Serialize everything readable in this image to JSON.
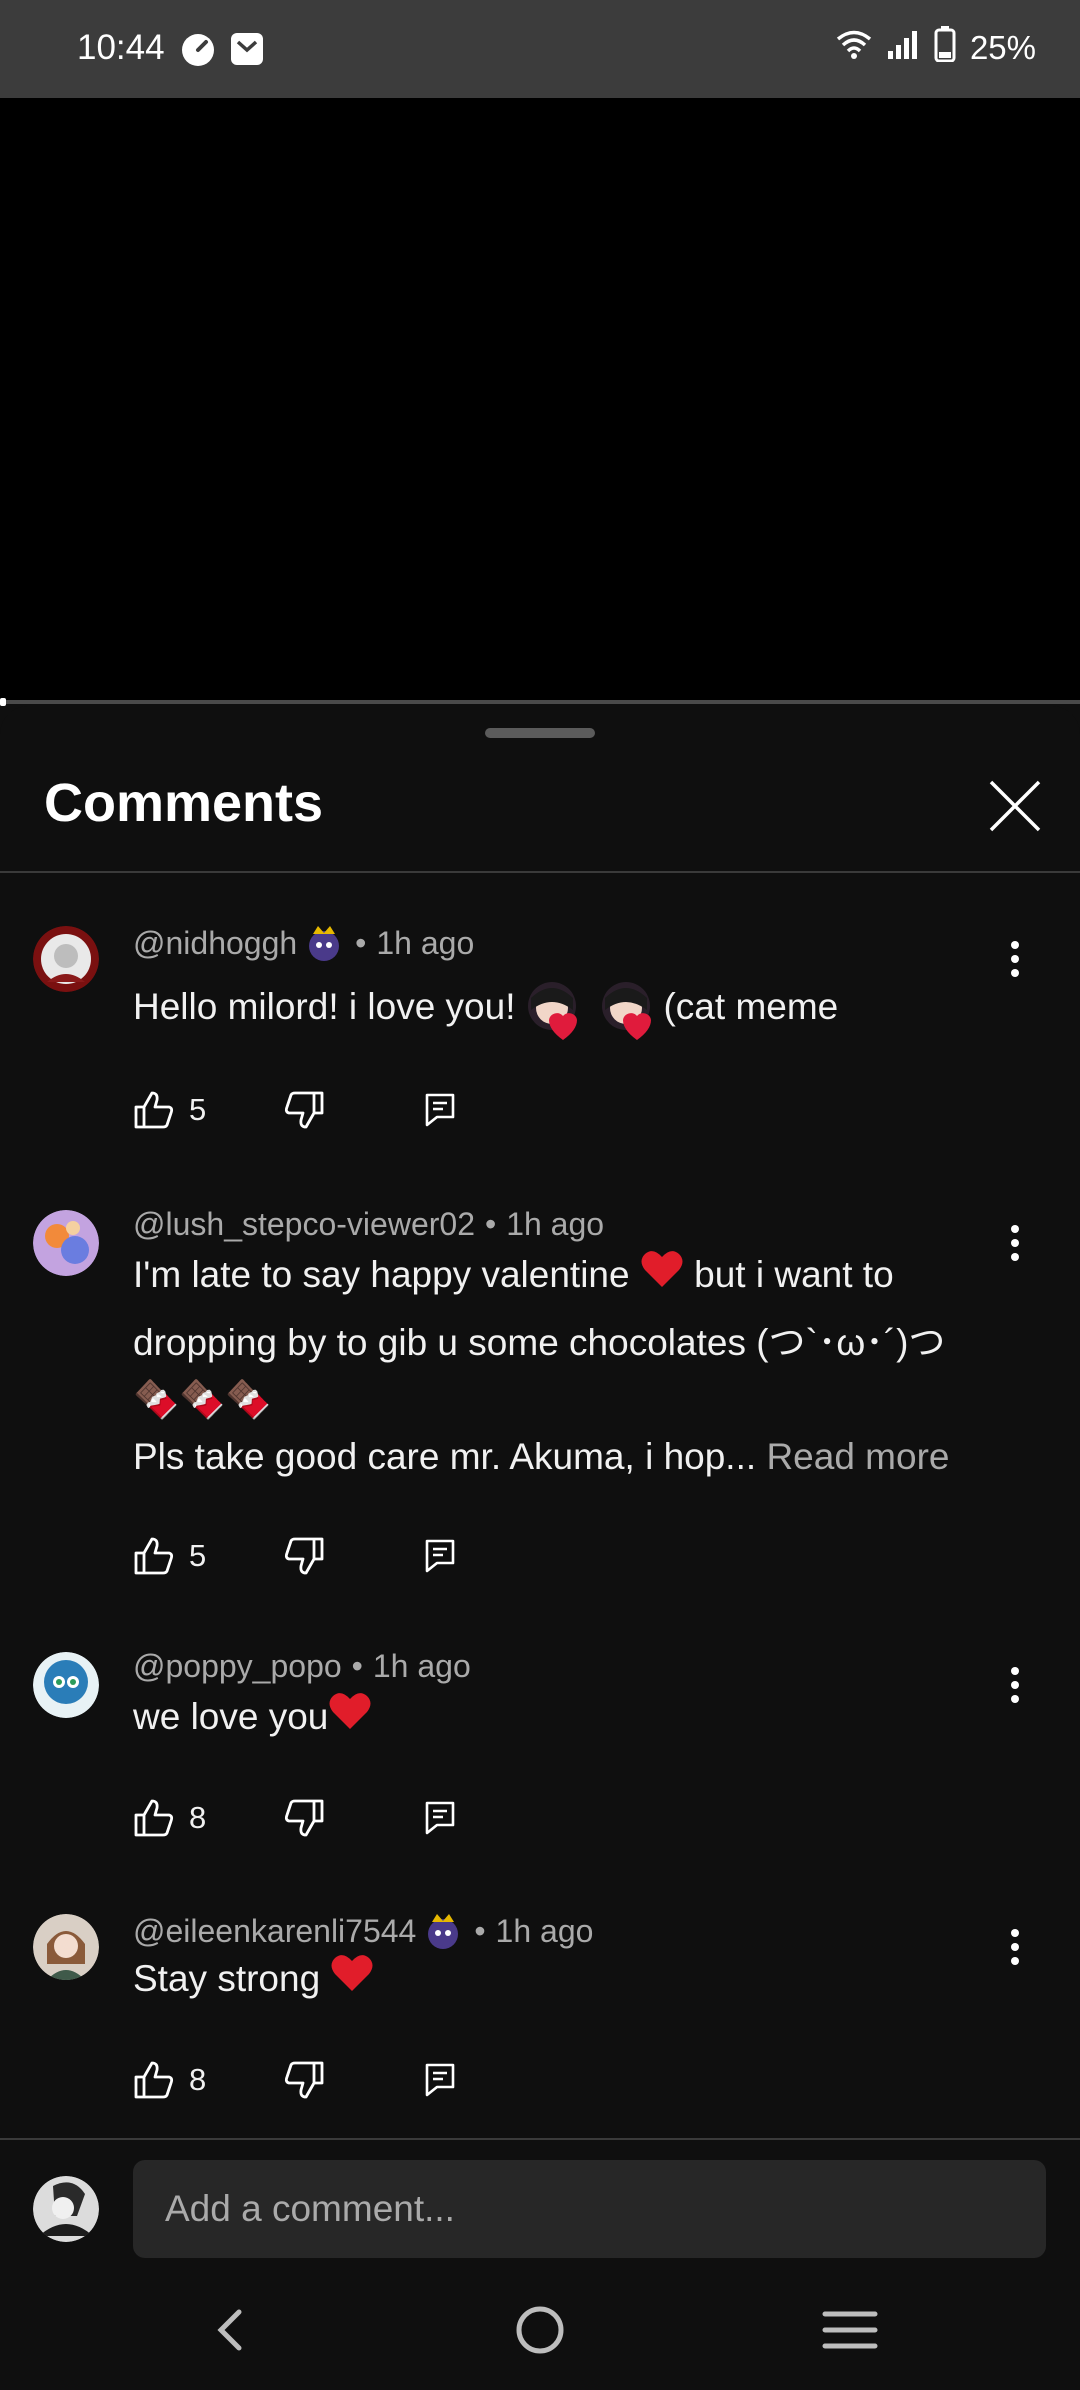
{
  "status_bar": {
    "time": "10:44",
    "battery": "25%"
  },
  "sheet": {
    "title": "Comments"
  },
  "comments": [
    {
      "author": "@nidhoggh",
      "time": "1h ago",
      "text_a": "Hello milord! i love you!",
      "text_b": "(cat meme",
      "likes": "5"
    },
    {
      "author": "@lush_stepco-viewer02",
      "time": "1h ago",
      "line1": "I'm late to say happy valentine",
      "line1b": " but i want to",
      "line2": "dropping by to gib u some chocolates (つ`･ω･´)つ",
      "line3": "🍫🍫🍫",
      "line4": "Pls take good care mr. Akuma, i hop...",
      "read_more": "Read more",
      "likes": "5"
    },
    {
      "author": "@poppy_popo",
      "time": "1h ago",
      "text": "we love you",
      "likes": "8"
    },
    {
      "author": "@eileenkarenli7544",
      "time": "1h ago",
      "text": "Stay strong",
      "likes": "8"
    }
  ],
  "composer": {
    "placeholder": "Add a comment..."
  },
  "colors": {
    "background": "#0f0f0f",
    "heart": "#e11d2a",
    "muted_text": "#aaaaaa"
  }
}
